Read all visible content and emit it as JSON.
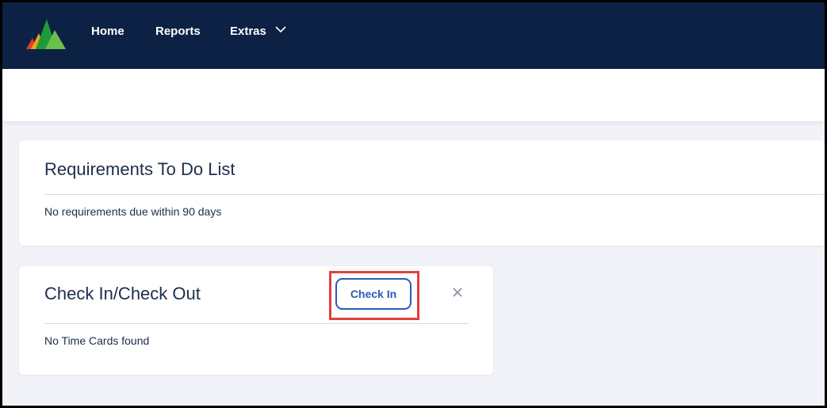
{
  "nav": {
    "items": [
      {
        "label": "Home"
      },
      {
        "label": "Reports"
      },
      {
        "label": "Extras"
      }
    ]
  },
  "requirements": {
    "title": "Requirements To Do List",
    "message": "No requirements due within 90 days"
  },
  "checkin": {
    "title": "Check In/Check Out",
    "button_label": "Check In",
    "message": "No Time Cards found"
  },
  "colors": {
    "navbar": "#0d2145",
    "accent": "#2d5ab5",
    "highlight": "#e0403a"
  },
  "icons": {
    "logo": "mountain-logo-icon",
    "extras_dropdown": "chevron-down-icon",
    "close": "close-icon"
  }
}
